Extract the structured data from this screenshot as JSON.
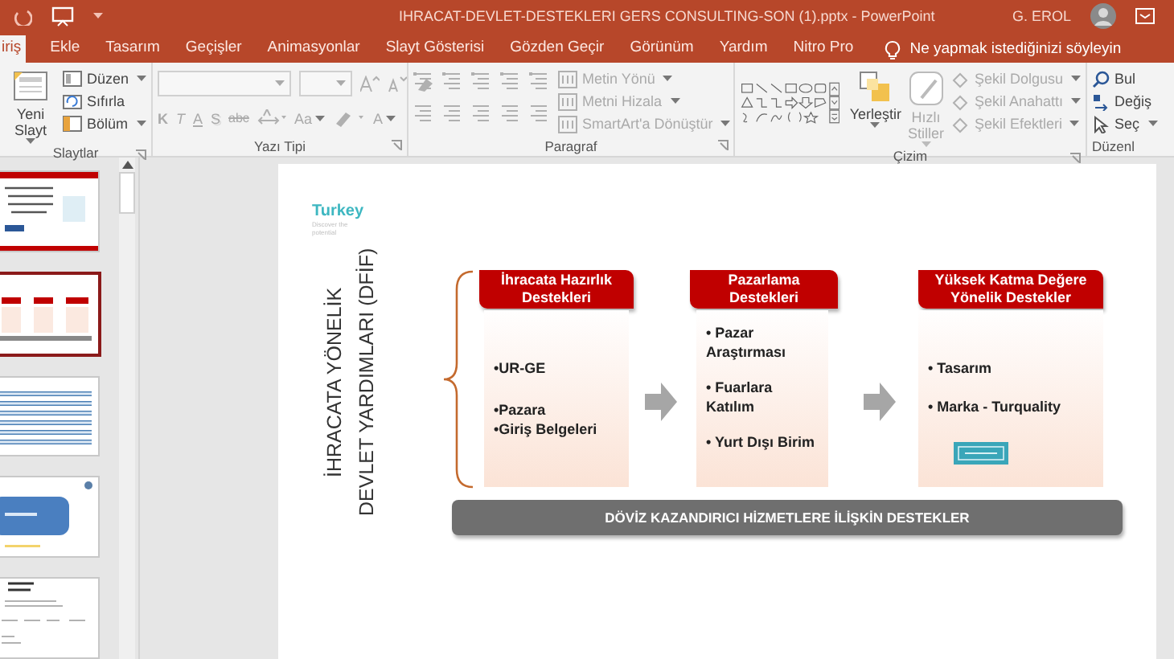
{
  "window": {
    "title": "IHRACAT-DEVLET-DESTEKLERI GERS CONSULTING-SON (1).pptx  -  PowerPoint",
    "user": "G. EROL"
  },
  "tabs": [
    {
      "label": "iriş",
      "selected": true
    },
    {
      "label": "Ekle",
      "selected": false
    },
    {
      "label": "Tasarım",
      "selected": false
    },
    {
      "label": "Geçişler",
      "selected": false
    },
    {
      "label": "Animasyonlar",
      "selected": false
    },
    {
      "label": "Slayt Gösterisi",
      "selected": false
    },
    {
      "label": "Gözden Geçir",
      "selected": false
    },
    {
      "label": "Görünüm",
      "selected": false
    },
    {
      "label": "Yardım",
      "selected": false
    },
    {
      "label": "Nitro Pro",
      "selected": false
    }
  ],
  "tell_me": {
    "placeholder": "Ne yapmak istediğinizi söyleyin"
  },
  "ribbon": [
    {
      "kind": "slides",
      "label": "Slaytlar",
      "disabled": false,
      "big": {
        "label": "Yeni Slayt",
        "dropdown": true
      },
      "commands": [
        {
          "label": "Düzen",
          "dropdown": true
        },
        {
          "label": "Sıfırla",
          "dropdown": false
        },
        {
          "label": "Bölüm",
          "dropdown": true
        }
      ]
    },
    {
      "kind": "font",
      "label": "Yazı Tipi",
      "disabled": true,
      "buttons": [
        {
          "text": "K",
          "dropdown": false
        },
        {
          "text": "T",
          "dropdown": false
        },
        {
          "text": "A",
          "dropdown": false
        },
        {
          "text": "S",
          "dropdown": false
        },
        {
          "text": "abc",
          "dropdown": false
        },
        {
          "text": "Aa",
          "dropdown": true
        },
        {
          "text": "A",
          "dropdown": true
        }
      ]
    },
    {
      "kind": "paragraph",
      "label": "Paragraf",
      "disabled": true,
      "commands": [
        {
          "label": "Metin Yönü",
          "dropdown": true
        },
        {
          "label": "Metni Hizala",
          "dropdown": true
        },
        {
          "label": "SmartArt'a Dönüştür",
          "dropdown": true
        }
      ]
    },
    {
      "kind": "drawing",
      "label": "Çizim",
      "arrange": {
        "label": "Yerleştir",
        "dropdown": true,
        "disabled": false
      },
      "quick_styles": {
        "label": "Hızlı Stiller",
        "dropdown": true,
        "disabled": true
      },
      "commands": [
        {
          "label": "Şekil Dolgusu",
          "dropdown": true,
          "disabled": true
        },
        {
          "label": "Şekil Anahattı",
          "dropdown": true,
          "disabled": true
        },
        {
          "label": "Şekil Efektleri",
          "dropdown": true,
          "disabled": true
        }
      ]
    },
    {
      "kind": "editing",
      "label": "Düzenl",
      "disabled": false,
      "commands": [
        {
          "label": "Bul",
          "dropdown": false
        },
        {
          "label": "Değiş",
          "dropdown": false
        },
        {
          "label": "Seç",
          "dropdown": true
        }
      ]
    }
  ],
  "thumbnails": [
    {
      "selected": false
    },
    {
      "selected": true
    },
    {
      "selected": false
    },
    {
      "selected": false
    },
    {
      "selected": false
    }
  ],
  "slide": {
    "logo": {
      "name": "Turkey",
      "tagline": "Discover the potential"
    },
    "vertical_title": [
      "İHRACATA  YÖNELİK",
      "DEVLET YARDIMLARI  (DFİF)"
    ],
    "columns": [
      {
        "header": "İhracata Hazırlık Destekleri",
        "paragraphs": [
          [
            "•UR-GE"
          ],
          [
            "•Pazara",
            "•Giriş  Belgeleri"
          ]
        ],
        "logo": false
      },
      {
        "header": "Pazarlama Destekleri",
        "paragraphs": [
          [
            "• Pazar Araştırması"
          ],
          [
            "• Fuarlara Katılım"
          ],
          [
            "• Yurt Dışı Birim"
          ]
        ],
        "logo": false
      },
      {
        "header": "Yüksek Katma Değere Yönelik Destekler",
        "paragraphs": [
          [
            "• Tasarım"
          ],
          [
            "• Marka - Turquality"
          ]
        ],
        "logo": true
      }
    ],
    "footer": "DÖVİZ KAZANDIRICI HİZMETLERE İLİŞKİN DESTEKLER"
  }
}
